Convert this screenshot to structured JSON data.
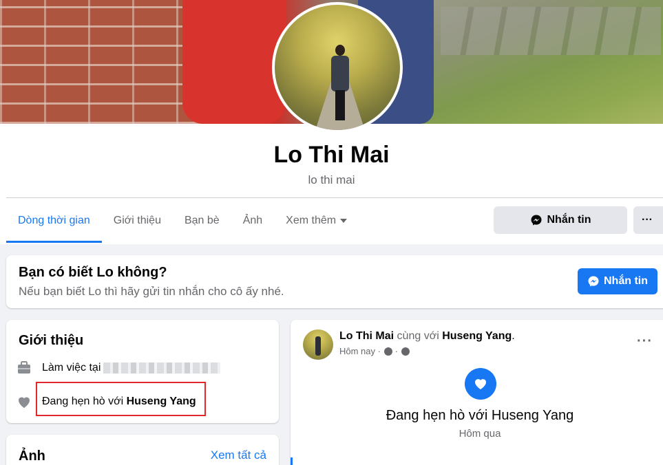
{
  "profile": {
    "name": "Lo Thi Mai",
    "alternate_name": "lo thi mai"
  },
  "tabs": [
    {
      "label": "Dòng thời gian",
      "active": true
    },
    {
      "label": "Giới thiệu",
      "active": false
    },
    {
      "label": "Bạn bè",
      "active": false
    },
    {
      "label": "Ảnh",
      "active": false
    },
    {
      "label": "Xem thêm",
      "active": false
    }
  ],
  "actions": {
    "message_label": "Nhắn tin",
    "more_label": "···"
  },
  "know_card": {
    "title": "Bạn có biết Lo không?",
    "subtitle": "Nếu bạn biết Lo thì hãy gửi tin nhắn cho cô ấy nhé.",
    "button_label": "Nhắn tin"
  },
  "intro": {
    "title": "Giới thiệu",
    "work_prefix": "Làm việc tại",
    "dating_prefix": "Đang hẹn hò với ",
    "dating_partner": "Huseng Yang"
  },
  "photos": {
    "title": "Ảnh",
    "see_all": "Xem tất cả"
  },
  "post": {
    "author": "Lo Thi Mai",
    "with_text": " cùng với ",
    "tagged": "Huseng Yang",
    "period": ".",
    "time": "Hôm nay ·",
    "menu": "···",
    "event": "Đang hẹn hò với Huseng Yang",
    "event_time": "Hôm qua"
  },
  "colors": {
    "accent": "#1877f2",
    "highlight_box": "#e0272d"
  }
}
